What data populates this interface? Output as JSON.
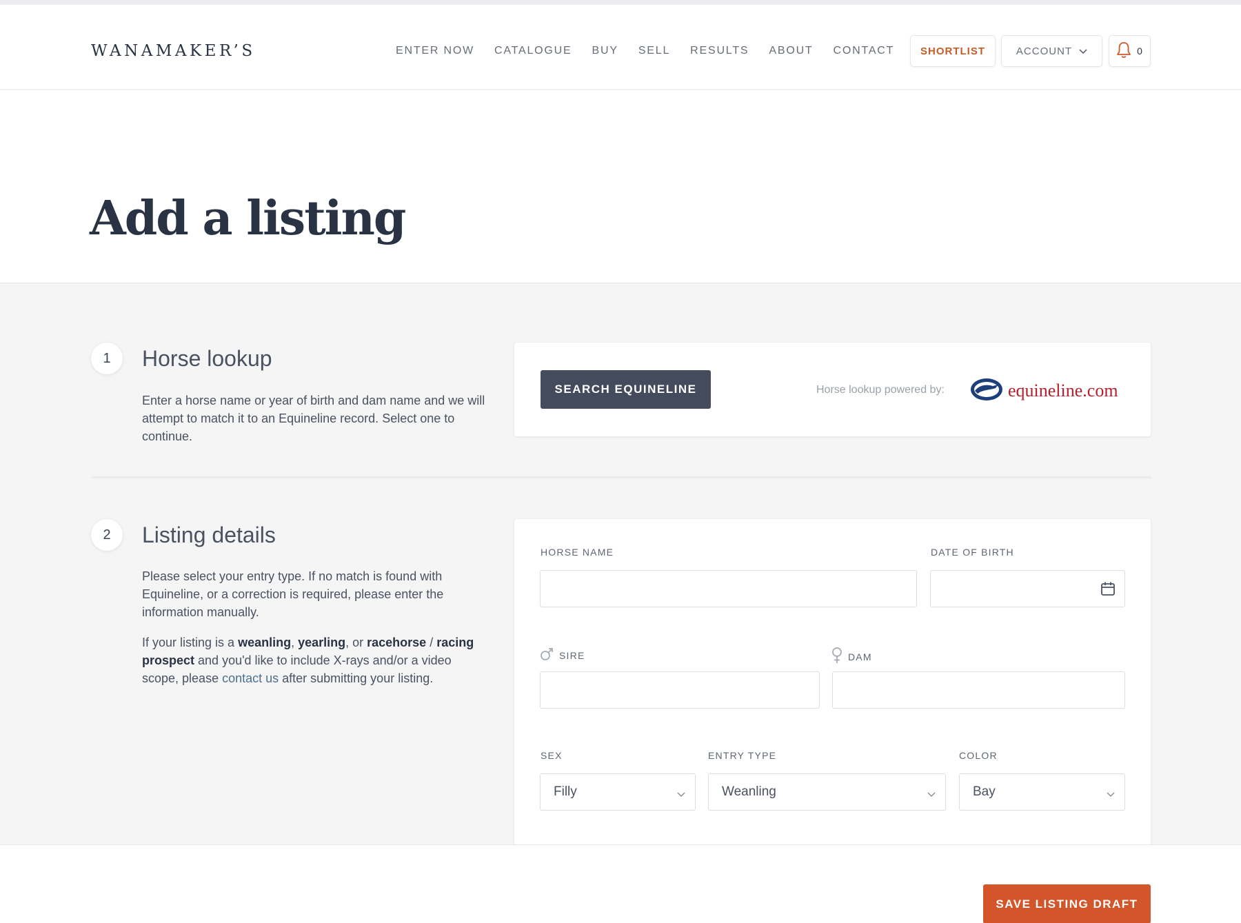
{
  "brand": {
    "logo": "WANAMAKER’S"
  },
  "nav": {
    "items": [
      {
        "label": "ENTER NOW"
      },
      {
        "label": "CATALOGUE"
      },
      {
        "label": "BUY"
      },
      {
        "label": "SELL"
      },
      {
        "label": "RESULTS"
      },
      {
        "label": "ABOUT"
      },
      {
        "label": "CONTACT"
      }
    ]
  },
  "header_actions": {
    "shortlist_label": "SHORTLIST",
    "account_label": "ACCOUNT",
    "notification_count": "0"
  },
  "page": {
    "title": "Add a listing"
  },
  "sections": {
    "lookup": {
      "number": "1",
      "title": "Horse lookup",
      "description": "Enter a horse name or year of birth and dam name and we will attempt to match it to an Equineline record. Select one to continue.",
      "search_button": "SEARCH EQUINELINE",
      "powered_by": "Horse lookup powered by:",
      "partner_name": "equineline.com"
    },
    "details": {
      "number": "2",
      "title": "Listing details",
      "paragraph1": "Please select your entry type. If no match is found with Equineline, or a correction is required, please enter the information manually.",
      "p2_part1": "If your listing is a ",
      "p2_weanling": "weanling",
      "p2_comma": ", ",
      "p2_yearling": "yearling",
      "p2_or": ", or ",
      "p2_racehorse": "racehorse",
      "p2_slash": " / ",
      "p2_racing_prospect": "racing prospect",
      "p2_part2": " and you'd like to include X-rays and/or a video scope, please ",
      "p2_link": "contact us",
      "p2_part3": " after submitting your listing."
    }
  },
  "form": {
    "horse_name": {
      "label": "HORSE NAME",
      "value": ""
    },
    "date_of_birth": {
      "label": "DATE OF BIRTH",
      "value": ""
    },
    "sire": {
      "label": "SIRE",
      "value": ""
    },
    "dam": {
      "label": "DAM",
      "value": ""
    },
    "sex": {
      "label": "SEX",
      "value": "Filly"
    },
    "entry_type": {
      "label": "ENTRY TYPE",
      "value": "Weanling"
    },
    "color": {
      "label": "COLOR",
      "value": "Bay"
    }
  },
  "footer": {
    "save_button": "SAVE LISTING DRAFT"
  },
  "colors": {
    "accent": "#d2562a",
    "dark_button": "#434b5d",
    "text": "#2a3344",
    "partner": "#b5202b"
  },
  "icons": [
    "chevron-down-icon",
    "bell-icon",
    "calendar-icon",
    "male-icon",
    "female-icon",
    "equineline-logo-icon"
  ]
}
